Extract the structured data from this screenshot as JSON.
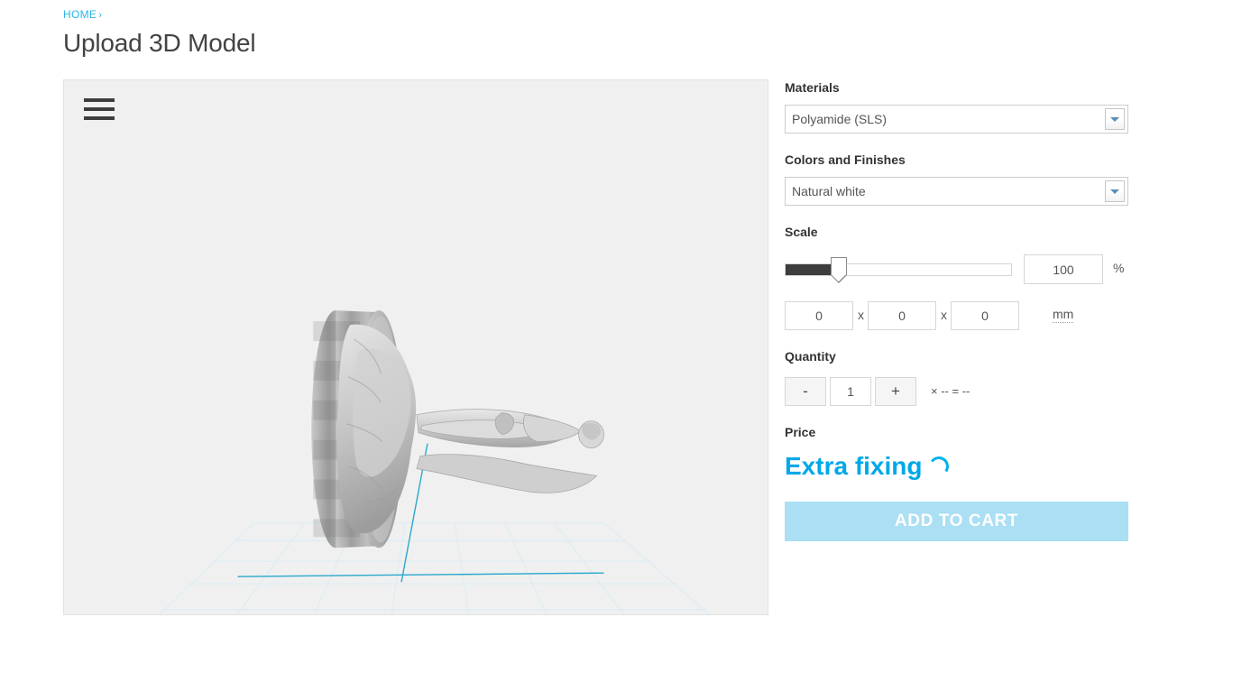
{
  "breadcrumb": {
    "home_label": "HOME",
    "separator": "›"
  },
  "page": {
    "title": "Upload 3D Model"
  },
  "viewer": {
    "menu_icon": "hamburger-menu-icon",
    "model_name": "3d-model-preview",
    "background_color": "#f0f0f0",
    "grid_color": "#d9ecf5",
    "axis_color": "#2aa8cc"
  },
  "config": {
    "materials": {
      "label": "Materials",
      "selected": "Polyamide (SLS)",
      "dropdown_icon": "chevron-down-icon"
    },
    "colors_finishes": {
      "label": "Colors and Finishes",
      "selected": "Natural white",
      "dropdown_icon": "chevron-down-icon"
    },
    "scale": {
      "label": "Scale",
      "slider_percent": 24,
      "percent_value": "100",
      "percent_unit": "%",
      "dimensions": {
        "x": "0",
        "y": "0",
        "z": "0",
        "separator": "x",
        "unit": "mm"
      }
    },
    "quantity": {
      "label": "Quantity",
      "decrement_label": "-",
      "increment_label": "+",
      "value": "1",
      "calculation": "× -- = --"
    },
    "price": {
      "label": "Price",
      "value": "Extra fixing",
      "loading_icon": "loading-spinner-icon",
      "accent_color": "#00a8e8"
    },
    "add_to_cart": {
      "label": "ADD TO CART",
      "color": "#aadff4"
    }
  }
}
